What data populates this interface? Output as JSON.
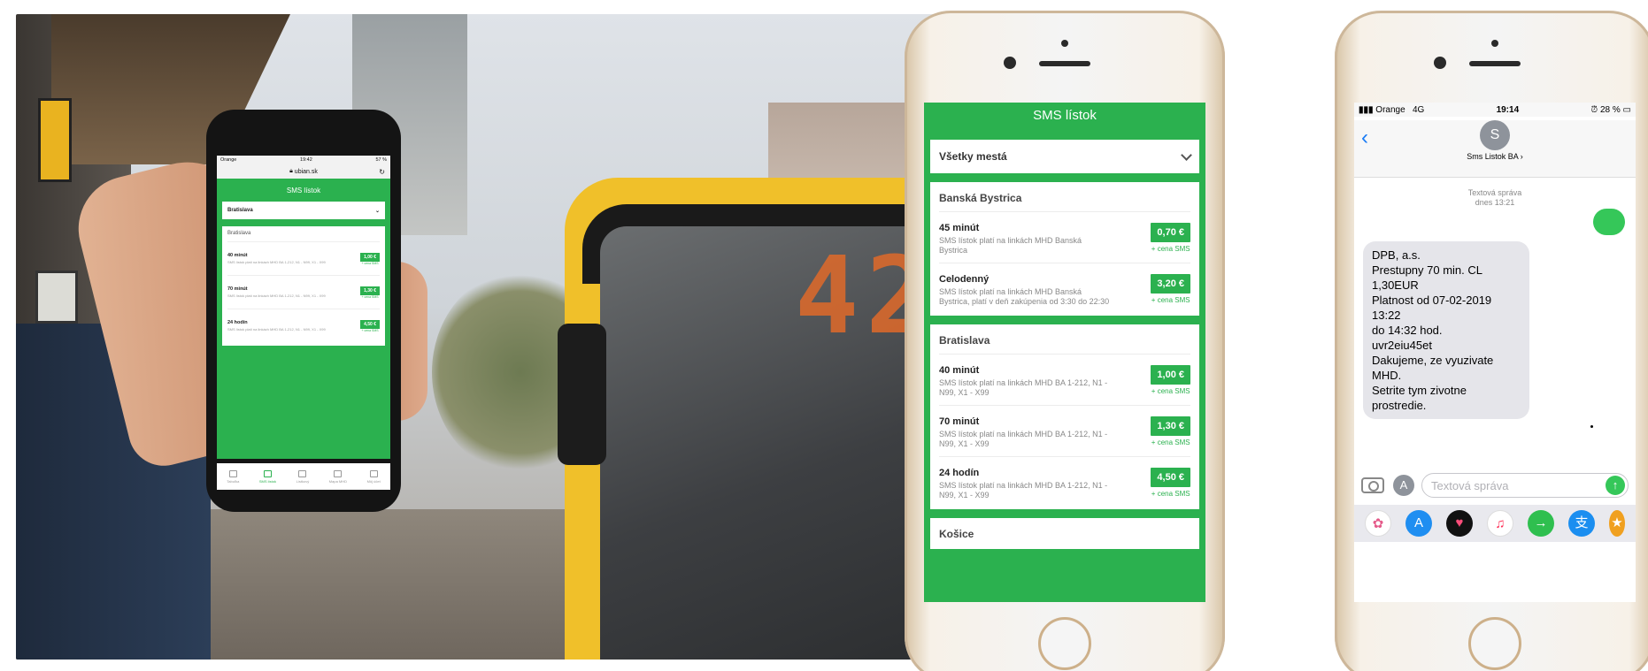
{
  "hand_phone": {
    "status_left": "Orange",
    "status_time": "19:42",
    "status_right": "57 %",
    "url": "ubian.sk",
    "title": "SMS lístok",
    "select": "Bratislava",
    "city": "Bratislava",
    "rows": [
      {
        "name": "40 minút",
        "desc": "SMS lístok platí na linkách MHD BA 1-212, N1 - N99, X1 - X99",
        "price": "1,00 €",
        "cena": "+ cena SMS"
      },
      {
        "name": "70 minút",
        "desc": "SMS lístok platí na linkách MHD BA 1-212, N1 - N99, X1 - X99",
        "price": "1,30 €",
        "cena": "+ cena SMS"
      },
      {
        "name": "24 hodín",
        "desc": "SMS lístok platí na linkách MHD BA 1-212, N1 - N99, X1 - X99",
        "price": "4,50 €",
        "cena": "+ cena SMS"
      }
    ],
    "tabs": [
      "Tabuľka",
      "SMS lístok",
      "Lístkový",
      "Mapa MHD",
      "Môj účet"
    ]
  },
  "middle_app": {
    "title": "SMS lístok",
    "select": "Všetky mestá",
    "cards": [
      {
        "city": "Banská Bystrica",
        "rows": [
          {
            "name": "45 minút",
            "desc": "SMS lístok platí na linkách MHD Banská Bystrica",
            "price": "0,70 €",
            "cena": "+ cena SMS"
          },
          {
            "name": "Celodenný",
            "desc": "SMS lístok platí na linkách MHD Banská Bystrica, platí v deň zakúpenia od 3:30 do 22:30",
            "price": "3,20 €",
            "cena": "+ cena SMS"
          }
        ]
      },
      {
        "city": "Bratislava",
        "rows": [
          {
            "name": "40 minút",
            "desc": "SMS lístok platí na linkách MHD BA 1-212, N1 - N99, X1 - X99",
            "price": "1,00 €",
            "cena": "+ cena SMS"
          },
          {
            "name": "70 minút",
            "desc": "SMS lístok platí na linkách MHD BA 1-212, N1 - N99, X1 - X99",
            "price": "1,30 €",
            "cena": "+ cena SMS"
          },
          {
            "name": "24 hodín",
            "desc": "SMS lístok platí na linkách MHD BA 1-212, N1 - N99, X1 - X99",
            "price": "4,50 €",
            "cena": "+ cena SMS"
          }
        ]
      },
      {
        "city": "Košice",
        "rows": []
      }
    ]
  },
  "messages": {
    "carrier": "Orange",
    "network": "4G",
    "time": "19:14",
    "battery": "28 %",
    "contact_initial": "S",
    "contact_name": "Sms Listok BA ›",
    "meta_line1": "Textová správa",
    "meta_line2": "dnes 13:21",
    "received_lines": [
      "DPB, a.s.",
      "Prestupny 70 min. CL 1,30EUR",
      "Platnost od 07-02-2019 13:22",
      "do 14:32 hod.",
      "uvr2eiu45et",
      "Dakujeme, ze vyuzivate MHD.",
      "Setrite tym zivotne prostredie."
    ],
    "input_placeholder": "Textová správa",
    "tray_apps": [
      {
        "name": "photos-app-icon",
        "color": "#ffffff",
        "glyph": "✿"
      },
      {
        "name": "appstore-app-icon",
        "color": "#1f8ef1",
        "glyph": "A"
      },
      {
        "name": "heart-app-icon",
        "color": "#111111",
        "glyph": "♥"
      },
      {
        "name": "music-app-icon",
        "color": "#ffffff",
        "glyph": "♫"
      },
      {
        "name": "transfer-app-icon",
        "color": "#2fbf4f",
        "glyph": "→"
      },
      {
        "name": "alipay-app-icon",
        "color": "#1b8ef0",
        "glyph": "支"
      },
      {
        "name": "extra-app-icon",
        "color": "#f0a020",
        "glyph": "★"
      }
    ]
  },
  "colors": {
    "brand_green": "#2bb14f",
    "ios_green": "#35c759",
    "ios_blue": "#1a7cf5"
  }
}
